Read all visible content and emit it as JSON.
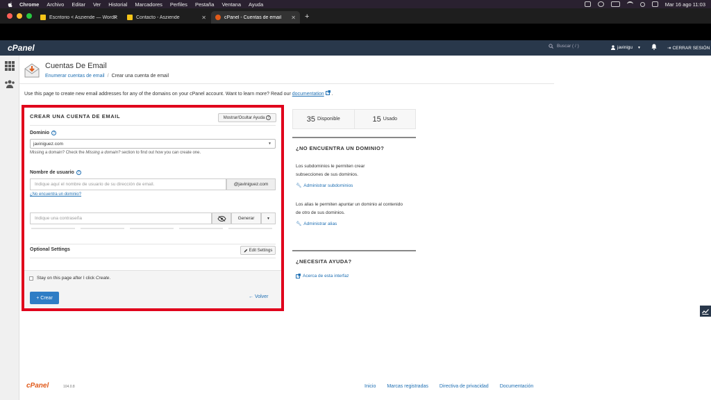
{
  "menubar": {
    "items": [
      "Chrome",
      "Archivo",
      "Editar",
      "Ver",
      "Historial",
      "Marcadores",
      "Perfiles",
      "Pestaña",
      "Ventana",
      "Ayuda"
    ],
    "clock": "Mar 16 ago  11:03"
  },
  "tabs": [
    {
      "label": "Escritorio < Asziende — WordP"
    },
    {
      "label": "Contacto - Asziende"
    },
    {
      "label": "cPanel - Cuentas de email"
    }
  ],
  "newtab": "+",
  "cpanel_header": {
    "logo": "cPanel",
    "search_placeholder": "Buscar ( / )",
    "user": "javinigu",
    "logout": "CERRAR SESIÓN"
  },
  "page": {
    "title": "Cuentas De Email",
    "breadcrumb": {
      "link": "Enumerar cuentas de email",
      "sep": "/",
      "current": "Crear una cuenta de email"
    },
    "intro_text": "Use this page to create new email addresses for any of the domains on your cPanel account. Want to learn more? Read our ",
    "intro_link": "documentation",
    "intro_end": " ."
  },
  "form": {
    "title": "CREAR UNA CUENTA DE EMAIL",
    "toggle_help": "Mostrar/Ocultar Ayuda",
    "domain_label": "Dominio",
    "domain_value": "javiniguez.com",
    "domain_hint_pre": "Missing a domain? Check the ",
    "domain_hint_em": "Missing a domain?",
    "domain_hint_post": " section to find out how you can create one.",
    "username_label": "Nombre de usuario",
    "username_placeholder": "Indique aquí el nombre de usuario de su dirección de email.",
    "username_suffix": "@javiniguez.com",
    "no_domain_link": "¿No encuentra un dominio?",
    "password_placeholder": "Indique una contraseña",
    "generate": "Generar",
    "optional_settings": "Optional Settings",
    "edit_settings": "Edit Settings",
    "stay_label_pre": "Stay on this page after I click ",
    "stay_label_em": "Create",
    "stay_label_post": ".",
    "create": "Crear",
    "back": "Volver"
  },
  "stats": {
    "available_num": "35",
    "available_label": "Disponible",
    "used_num": "15",
    "used_label": "Usado"
  },
  "right": {
    "no_domain_title": "¿NO ENCUENTRA UN DOMINIO?",
    "subdomains_text": "Los subdominios le permiten crear subsecciones de sus dominios.",
    "subdomains_link": "Administrar subdominios",
    "aliases_text": "Los alias le permiten apuntar un dominio al contenido de otro de sus dominios.",
    "aliases_link": "Administrar alias",
    "help_title": "¿NECESITA AYUDA?",
    "help_link": "Acerca de esta interfaz"
  },
  "footer": {
    "logo": "cPanel",
    "version": "104.0.8",
    "links": [
      "Inicio",
      "Marcas registradas",
      "Directiva de privacidad",
      "Documentación"
    ]
  },
  "colors": {
    "header": "#29384b",
    "link": "#1e6fb3",
    "highlight": "#e0001b",
    "primary_button": "#2f7dc5"
  }
}
